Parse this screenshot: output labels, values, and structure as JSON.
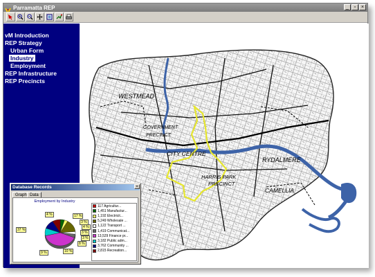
{
  "window": {
    "title": "Parramatta REP"
  },
  "toolbar": {
    "tools": [
      "select-arrow-icon",
      "zoom-in-icon",
      "zoom-out-icon",
      "pan-icon",
      "full-extent-icon",
      "identify-icon",
      "print-icon"
    ]
  },
  "sidebar": {
    "items": [
      {
        "label": "vM Introduction"
      },
      {
        "label": "REP Strategy"
      },
      {
        "label": "Urban Form"
      },
      {
        "label": "Industry",
        "selected": true
      },
      {
        "label": "Employment"
      },
      {
        "label": "REP Infrastructure"
      },
      {
        "label": "REP Precincts"
      }
    ]
  },
  "map": {
    "labels": {
      "westmead": "WESTMEAD",
      "government": "GOVERNMENT",
      "precinct": "PRECINCT",
      "city_centre": "CITY CENTRE",
      "harris_park": "HARRIS PARK",
      "harris_precinct": "PRECINCT",
      "rydalmere": "RYDALMERE",
      "camellia": "CAMELLIA"
    }
  },
  "db_window": {
    "title": "Database Records",
    "close": "×",
    "tabs": {
      "graph": "Graph",
      "data": "Data"
    }
  },
  "chart_data": {
    "type": "pie",
    "title": "Employment by Industry",
    "legend_entries": [
      {
        "label": "117 Agricultur...",
        "value": 117,
        "color": "#cc0000"
      },
      {
        "label": "1,451 Manufactur...",
        "value": 1451,
        "color": "#006600"
      },
      {
        "label": "1,192 Electricit...",
        "value": 1192,
        "color": "#ffff66"
      },
      {
        "label": "5,249 Wholesale ...",
        "value": 5249,
        "color": "#666600"
      },
      {
        "label": "1,122 Transport ...",
        "value": 1122,
        "color": "#ffffff"
      },
      {
        "label": "1,419 Communicat...",
        "value": 1419,
        "color": "#666666"
      },
      {
        "label": "13,529 Finance pr...",
        "value": 13529,
        "color": "#cc33cc"
      },
      {
        "label": "3,182 Public adm...",
        "value": 3182,
        "color": "#00cccc"
      },
      {
        "label": "3,762 Community ...",
        "value": 3762,
        "color": "#000080"
      },
      {
        "label": "2,815 Recreation...",
        "value": 2815,
        "color": "#800000"
      }
    ],
    "percent_labels": [
      "4 %",
      "17 %",
      "3 %",
      "4 %",
      "3 %",
      "37 %",
      "3 %",
      "8 %",
      "9 %",
      "10 %"
    ]
  },
  "colors": {
    "sidebar_bg": "#000080",
    "river": "#3d63a8",
    "precinct_outline": "#e6e62e"
  }
}
